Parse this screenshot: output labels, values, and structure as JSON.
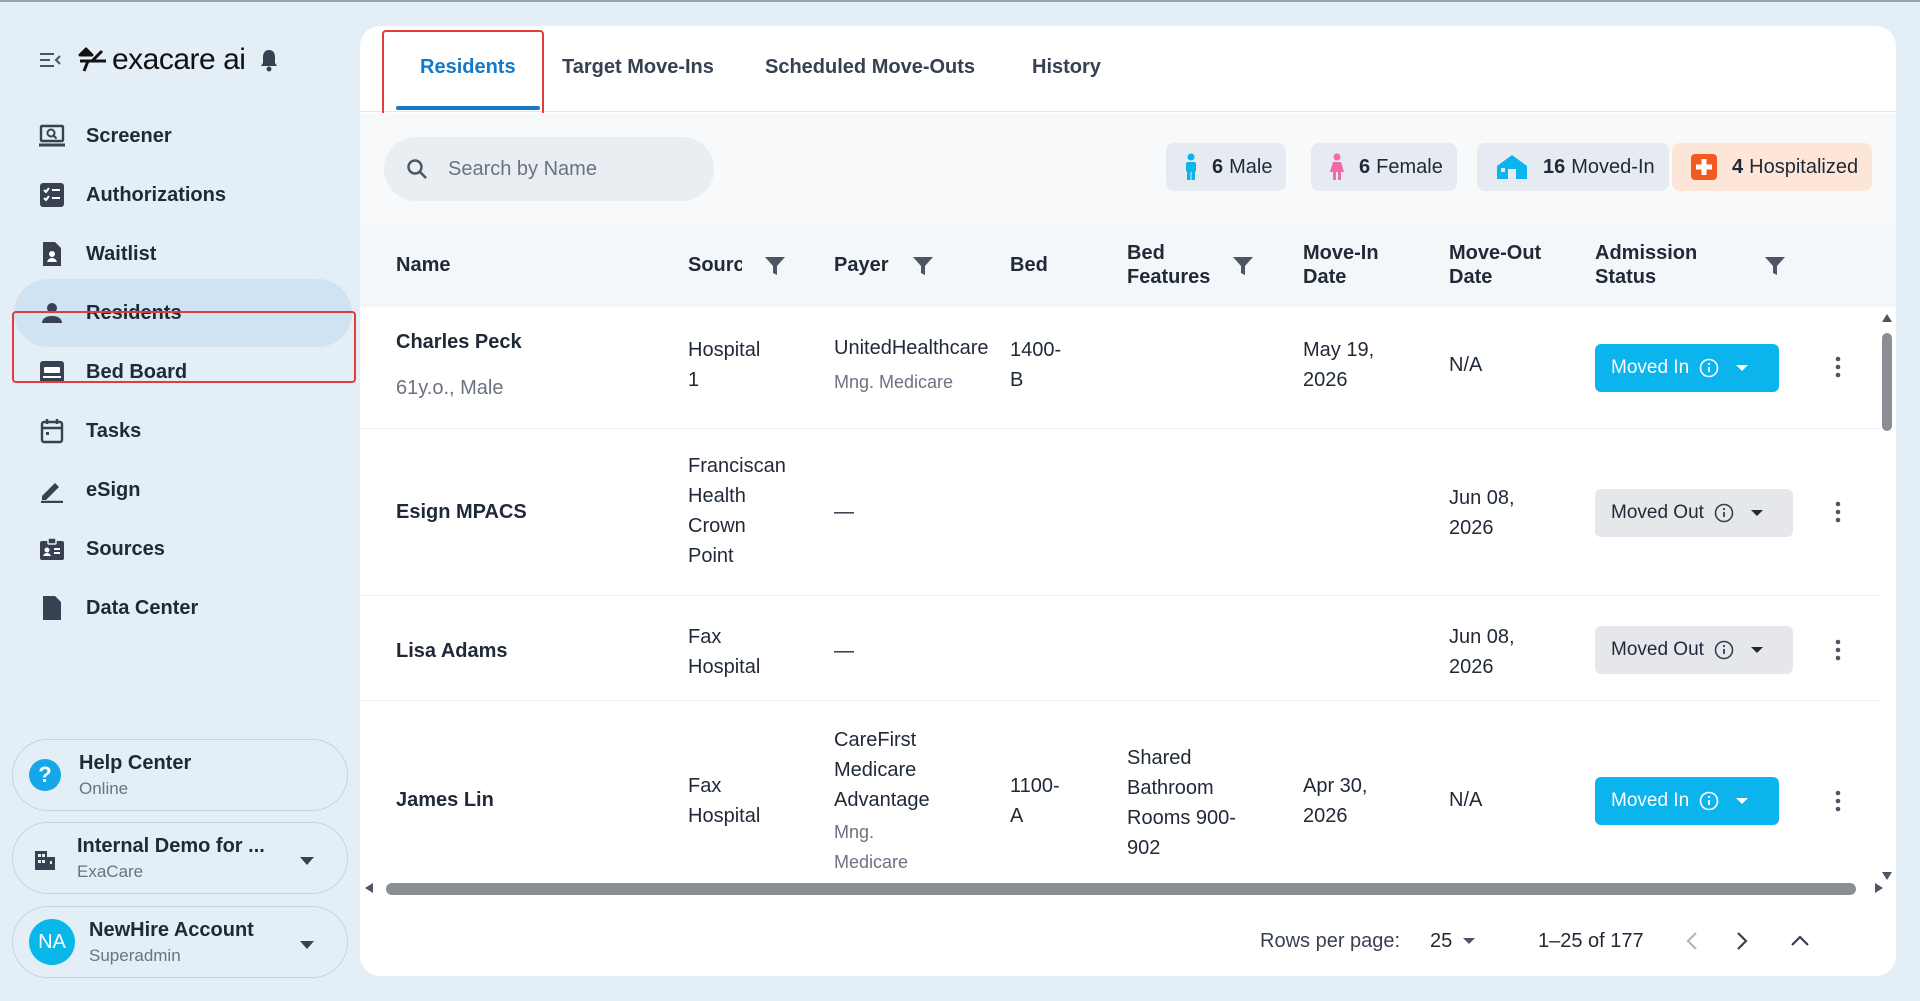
{
  "brand": {
    "name": "exacare ai"
  },
  "sidebar": {
    "items": [
      {
        "label": "Screener"
      },
      {
        "label": "Authorizations"
      },
      {
        "label": "Waitlist"
      },
      {
        "label": "Residents"
      },
      {
        "label": "Bed Board"
      },
      {
        "label": "Tasks"
      },
      {
        "label": "eSign"
      },
      {
        "label": "Sources"
      },
      {
        "label": "Data Center"
      }
    ],
    "help": {
      "title": "Help Center",
      "status": "Online"
    },
    "org": {
      "name": "Internal Demo for ...",
      "sub": "ExaCare"
    },
    "account": {
      "initials": "NA",
      "name": "NewHire Account",
      "role": "Superadmin"
    }
  },
  "tabs": [
    "Residents",
    "Target Move-Ins",
    "Scheduled Move-Outs",
    "History"
  ],
  "search": {
    "placeholder": "Search by Name"
  },
  "chips": {
    "male": {
      "count": "6",
      "label": "Male"
    },
    "female": {
      "count": "6",
      "label": "Female"
    },
    "movedin": {
      "count": "16",
      "label": "Moved-In"
    },
    "hospitalized": {
      "count": "4",
      "label": "Hospitalized"
    }
  },
  "columns": {
    "name": "Name",
    "source": "Sourc",
    "payer": "Payer",
    "bed": "Bed",
    "bed_features_1": "Bed",
    "bed_features_2": "Features",
    "move_in_1": "Move-In",
    "move_in_2": "Date",
    "move_out_1": "Move-Out",
    "move_out_2": "Date",
    "admission_1": "Admission",
    "admission_2": "Status"
  },
  "rows": [
    {
      "name": "Charles Peck",
      "sub": "61y.o., Male",
      "source": [
        "Hospital",
        "1"
      ],
      "payer": "UnitedHealthcare",
      "payer_sub": "Mng. Medicare",
      "bed": [
        "1400-",
        "B"
      ],
      "features": [],
      "move_in": [
        "May 19,",
        "2026"
      ],
      "move_out": [
        "N/A"
      ],
      "status": "Moved In"
    },
    {
      "name": "Esign MPACS",
      "source": [
        "Franciscan",
        "Health",
        "Crown",
        "Point"
      ],
      "payer": "—",
      "move_out": [
        "Jun 08,",
        "2026"
      ],
      "status": "Moved Out"
    },
    {
      "name": "Lisa Adams",
      "source": [
        "Fax",
        "Hospital"
      ],
      "payer": "—",
      "move_out": [
        "Jun 08,",
        "2026"
      ],
      "status": "Moved Out"
    },
    {
      "name": "James Lin",
      "source": [
        "Fax",
        "Hospital"
      ],
      "payer_lines": [
        "CareFirst",
        "Medicare",
        "Advantage"
      ],
      "payer_sub_lines": [
        "Mng.",
        "Medicare"
      ],
      "bed": [
        "1100-",
        "A"
      ],
      "features": [
        "Shared",
        "Bathroom",
        "Rooms 900-",
        "902"
      ],
      "move_in": [
        "Apr 30,",
        "2026"
      ],
      "move_out": [
        "N/A"
      ],
      "status": "Moved In"
    }
  ],
  "pagination": {
    "rows_per_page_label": "Rows per page:",
    "rows_per_page": "25",
    "range": "1–25 of 177"
  },
  "colors": {
    "accent": "#1479c9",
    "moved_in": "#0bb4ec",
    "hospital": "#f25a22",
    "male": "#0bb4ec",
    "female": "#f06aa8",
    "highlight_box": "#e23b3b"
  }
}
